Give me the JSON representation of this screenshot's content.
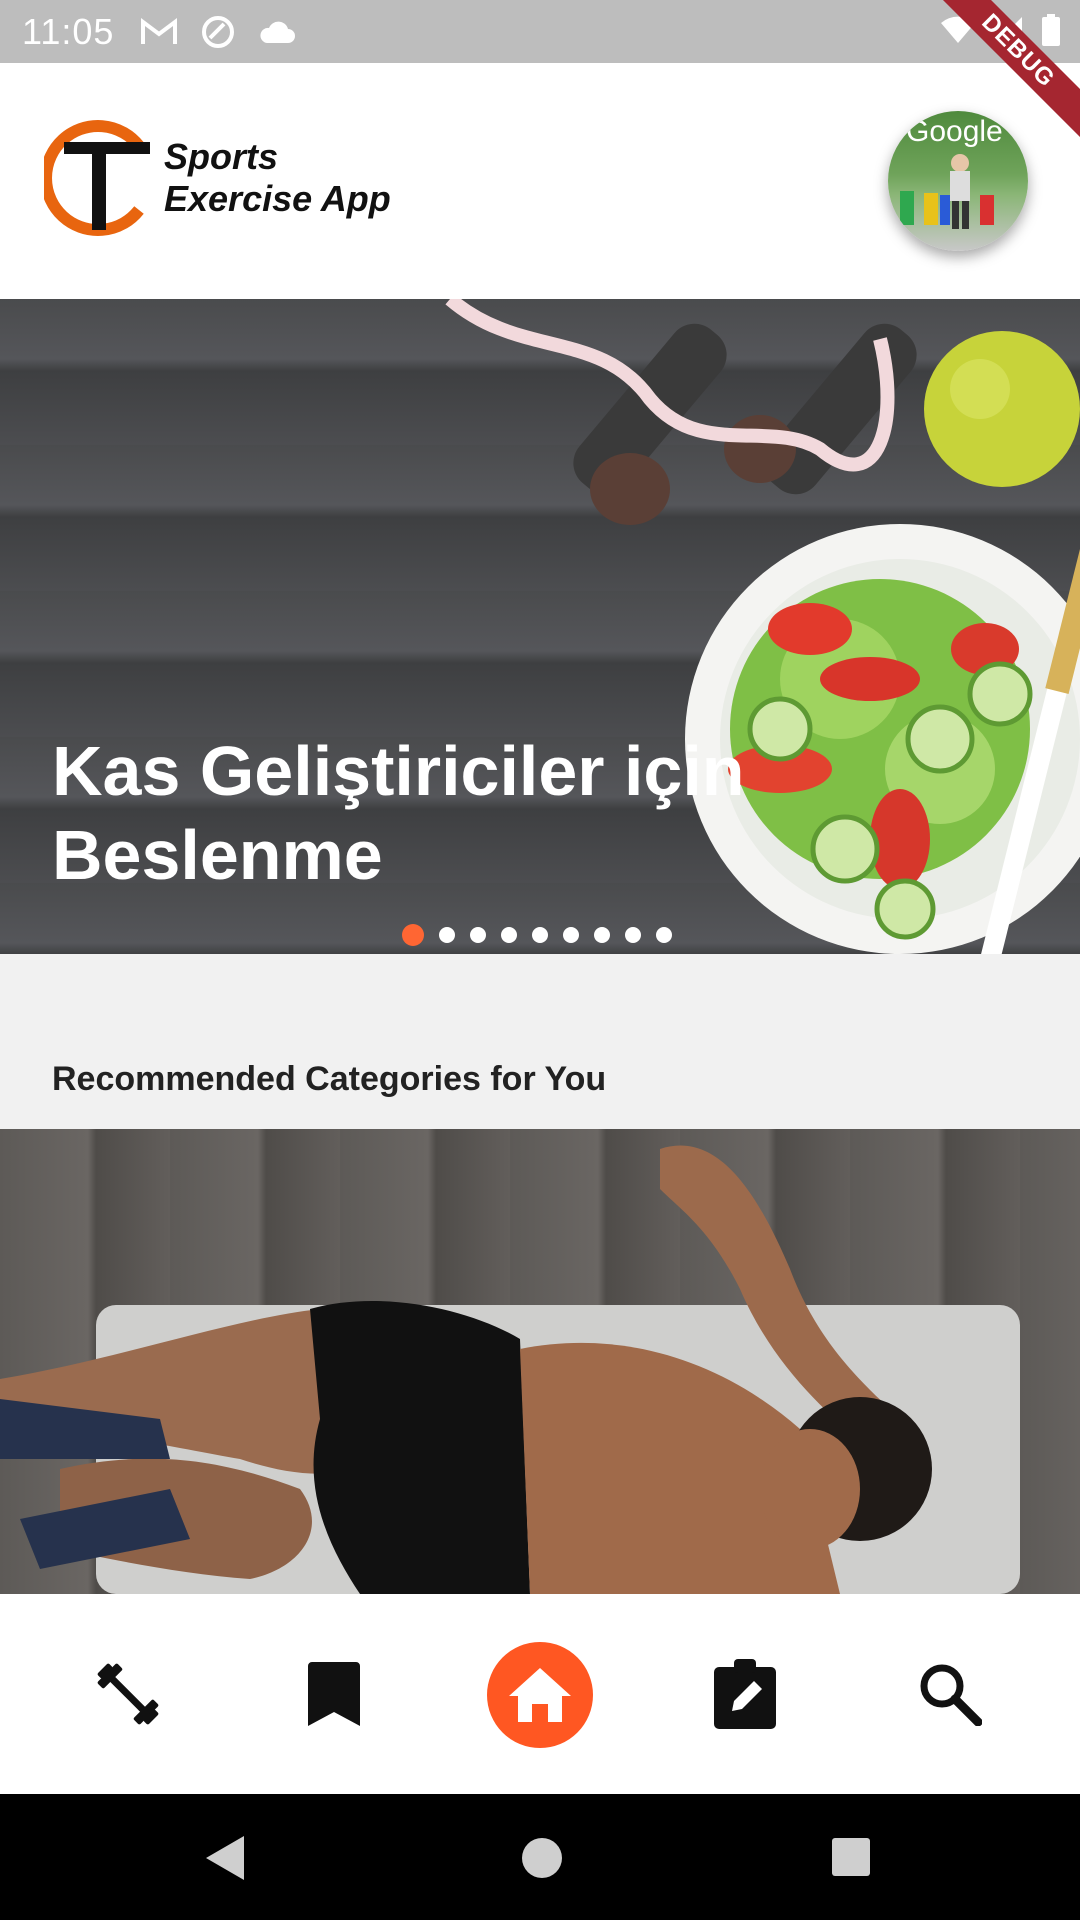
{
  "status_bar": {
    "time": "11:05",
    "left_icons": [
      "gmail-icon",
      "sync-icon",
      "cloud-icon"
    ],
    "right_icons": [
      "wifi-icon",
      "signal-icon",
      "battery-icon"
    ],
    "debug_label": "DEBUG"
  },
  "header": {
    "logo_line1": "Sports",
    "logo_line2": "Exercise App",
    "avatar_text": "Google"
  },
  "banner": {
    "title": "Kas Geliştiriciler için Beslenme",
    "page_count": 9,
    "active_index": 0
  },
  "section": {
    "title": "Recommended Categories for You"
  },
  "bottom_nav": {
    "items": [
      "dumbbell-icon",
      "bookmark-icon",
      "home-icon",
      "clipboard-edit-icon",
      "search-icon"
    ],
    "active": "home-icon"
  },
  "colors": {
    "accent": "#ff5722",
    "status_bar": "#bdbdbd",
    "debug_ribbon": "#a52630"
  }
}
